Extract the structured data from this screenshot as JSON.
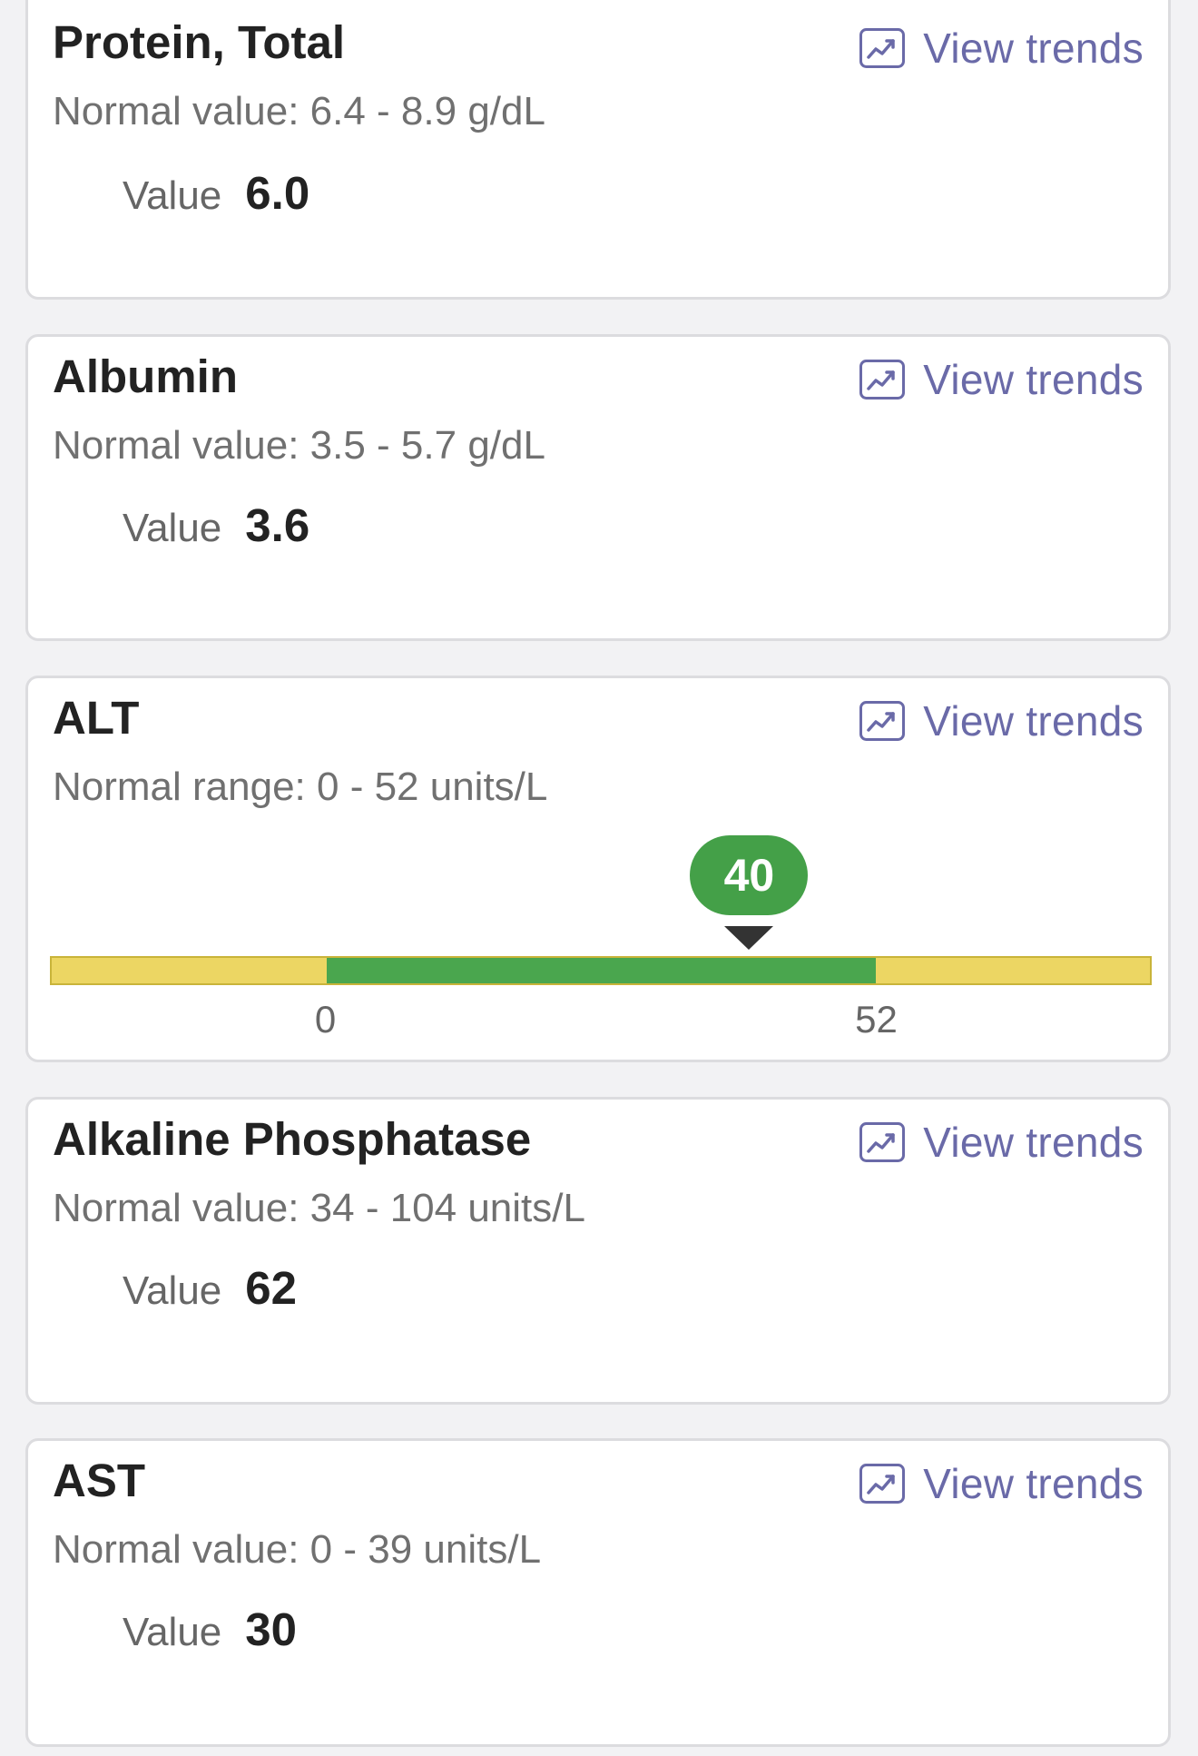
{
  "trends_label": "View trends",
  "cards": [
    {
      "title": "Protein, Total",
      "normal": "Normal value: 6.4 - 8.9 g/dL",
      "value_label": "Value",
      "value": "6.0"
    },
    {
      "title": "Albumin",
      "normal": "Normal value: 3.5 - 5.7 g/dL",
      "value_label": "Value",
      "value": "3.6"
    },
    {
      "title": "ALT",
      "normal": "Normal range: 0 - 52 units/L",
      "range_bar": {
        "value": 40,
        "value_label": "40",
        "normal_min": 0,
        "normal_max": 52,
        "scale_min": -26,
        "scale_max": 78,
        "min_label": "0",
        "max_label": "52",
        "colors": {
          "normal": "#4aa64e",
          "outside": "#ecd663",
          "bubble": "#44a048"
        }
      }
    },
    {
      "title": "Alkaline Phosphatase",
      "normal": "Normal value: 34 - 104 units/L",
      "value_label": "Value",
      "value": "62"
    },
    {
      "title": "AST",
      "normal": "Normal value: 0 - 39 units/L",
      "value_label": "Value",
      "value": "30"
    }
  ],
  "icons": {
    "trends": "trend-chart-icon"
  },
  "colors": {
    "accent": "#6a6aa8",
    "title": "#222222",
    "muted": "#707070",
    "card_border": "#dcdcdf",
    "background": "#f2f2f4"
  }
}
